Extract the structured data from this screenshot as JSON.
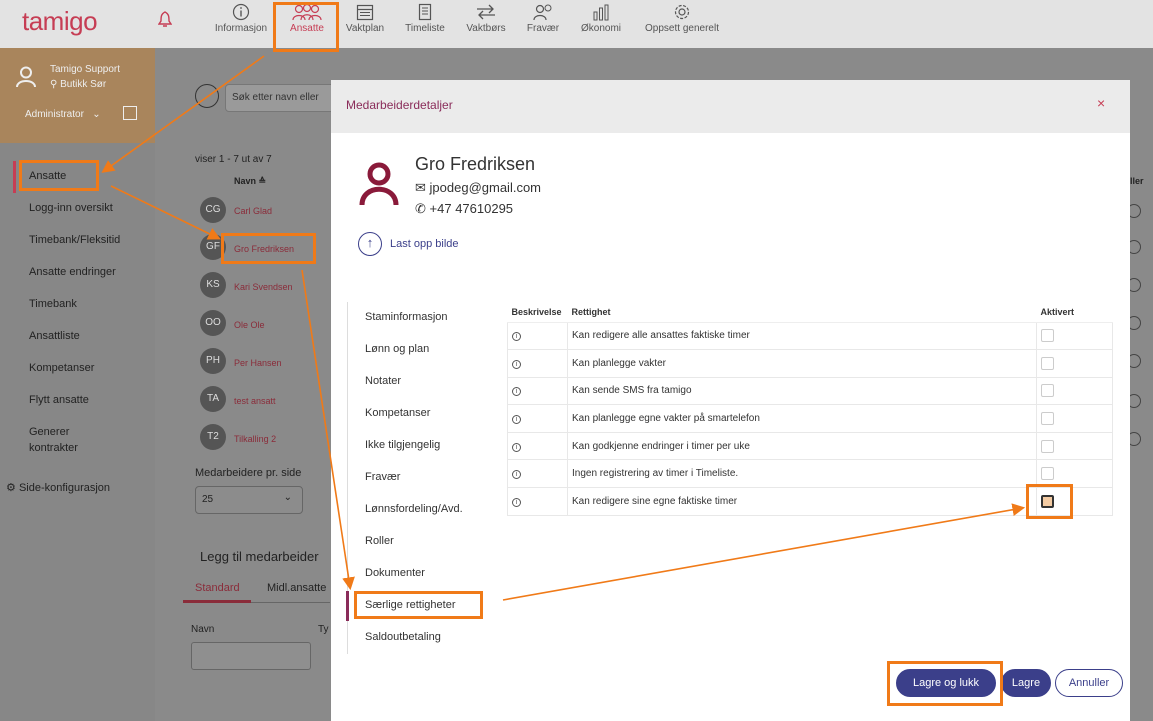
{
  "app": {
    "logo": "tamigo"
  },
  "nav": [
    {
      "label": "Informasjon",
      "icon": "info-icon"
    },
    {
      "label": "Ansatte",
      "icon": "people-icon"
    },
    {
      "label": "Vaktplan",
      "icon": "calendar-icon"
    },
    {
      "label": "Timeliste",
      "icon": "timesheet-icon"
    },
    {
      "label": "Vaktbørs",
      "icon": "swap-icon"
    },
    {
      "label": "Fravær",
      "icon": "absence-icon"
    },
    {
      "label": "Økonomi",
      "icon": "chart-icon"
    },
    {
      "label": "Oppsett generelt",
      "icon": "gear-icon"
    }
  ],
  "profile": {
    "name": "Tamigo Support",
    "location": "Butikk Sør",
    "role": "Administrator"
  },
  "sidebar": {
    "items": [
      {
        "label": "Ansatte"
      },
      {
        "label": "Logg-inn oversikt"
      },
      {
        "label": "Timebank/Fleksitid"
      },
      {
        "label": "Ansatte endringer"
      },
      {
        "label": "Timebank"
      },
      {
        "label": "Ansattliste"
      },
      {
        "label": "Kompetanser"
      },
      {
        "label": "Flytt ansatte"
      },
      {
        "label": "Generer"
      },
      {
        "label": "kontrakter"
      }
    ],
    "config": "Side-konfigurasjon"
  },
  "background": {
    "search_placeholder": "Søk etter navn eller",
    "showing": "viser 1 - 7 ut av 7",
    "name_header": "Navn ≙",
    "employees": [
      {
        "initials": "CG",
        "name": "Carl Glad"
      },
      {
        "initials": "GF",
        "name": "Gro Fredriksen"
      },
      {
        "initials": "KS",
        "name": "Kari Svendsen"
      },
      {
        "initials": "OO",
        "name": "Ole Ole"
      },
      {
        "initials": "PH",
        "name": "Per Hansen"
      },
      {
        "initials": "TA",
        "name": "test ansatt"
      },
      {
        "initials": "T2",
        "name": "Tilkalling 2"
      }
    ],
    "per_page_label": "Medarbeidere pr. side",
    "per_page_value": "25",
    "add_heading": "Legg til medarbeider",
    "tab_standard": "Standard",
    "tab_midl": "Midl.ansatte",
    "name_label": "Navn",
    "type_label": "Ty",
    "right_col_label": "ller"
  },
  "modal": {
    "title": "Medarbeiderdetaljer",
    "close": "×",
    "person": {
      "name": "Gro Fredriksen",
      "email": "jpodeg@gmail.com",
      "phone": "+47 47610295"
    },
    "upload": "Last opp bilde",
    "menu": [
      {
        "label": "Staminformasjon"
      },
      {
        "label": "Lønn og plan"
      },
      {
        "label": "Notater"
      },
      {
        "label": "Kompetanser"
      },
      {
        "label": "Ikke tilgjengelig"
      },
      {
        "label": "Fravær"
      },
      {
        "label": "Lønnsfordeling/Avd."
      },
      {
        "label": "Roller"
      },
      {
        "label": "Dokumenter"
      },
      {
        "label": "Særlige rettigheter"
      },
      {
        "label": "Saldoutbetaling"
      }
    ],
    "table": {
      "headers": [
        "Beskrivelse",
        "Rettighet",
        "Aktivert"
      ],
      "rows": [
        {
          "right": "Kan redigere alle ansattes faktiske timer",
          "active": false
        },
        {
          "right": "Kan planlegge vakter",
          "active": false
        },
        {
          "right": "Kan sende SMS fra tamigo",
          "active": false
        },
        {
          "right": "Kan planlegge egne vakter på smartelefon",
          "active": false
        },
        {
          "right": "Kan godkjenne endringer i timer per uke",
          "active": false
        },
        {
          "right": "Ingen registrering av timer i Timeliste.",
          "active": false
        },
        {
          "right": "Kan redigere sine egne faktiske timer",
          "active": false
        }
      ]
    },
    "buttons": {
      "save_close": "Lagre og lukk",
      "save": "Lagre",
      "cancel": "Annuller"
    }
  },
  "colors": {
    "brand": "#c63d54",
    "primary": "#3b3f8a",
    "highlight": "#f07a18"
  }
}
